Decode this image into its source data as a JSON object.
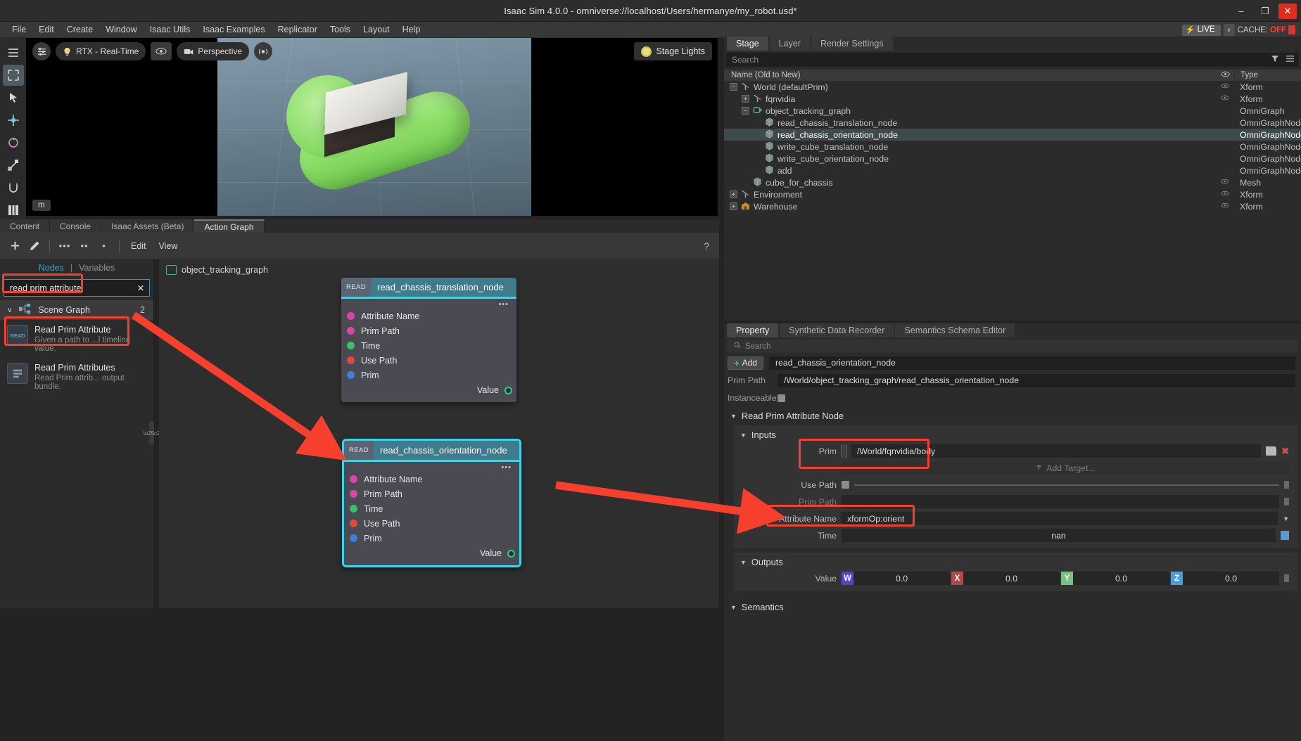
{
  "window": {
    "title": "Isaac Sim 4.0.0 - omniverse://localhost/Users/hermanye/my_robot.usd*",
    "minimize": "–",
    "maximize": "❐",
    "close": "✕"
  },
  "menubar": {
    "items": [
      "File",
      "Edit",
      "Create",
      "Window",
      "Isaac Utils",
      "Isaac Examples",
      "Replicator",
      "Tools",
      "Layout",
      "Help"
    ],
    "live_label": "LIVE",
    "live_bolt": "⚡",
    "live_caret": "∨",
    "cache_label": "CACHE:",
    "cache_value": "OFF"
  },
  "viewport": {
    "toolbar": {
      "settings_icon": "sliders-icon",
      "bulb_icon": "lightbulb-icon",
      "renderer": "RTX - Real-Time",
      "eye_icon": "eye-icon",
      "camera_icon": "camera-icon",
      "camera": "Perspective",
      "sensor_icon": "sensor-icon"
    },
    "stage_lights": "Stage Lights",
    "unit": "m"
  },
  "bottom_tabs": {
    "items": [
      "Content",
      "Console",
      "Isaac Assets (Beta)",
      "Action Graph"
    ],
    "active": "Action Graph"
  },
  "graph_toolbar": {
    "add_icon": "plus-icon",
    "edit_icon": "pencil-icon",
    "dots1": "•••",
    "dots2": "••",
    "dots3": "•",
    "edit": "Edit",
    "view": "View",
    "help": "?"
  },
  "node_library": {
    "tabs": {
      "nodes": "Nodes",
      "separator": "|",
      "variables": "Variables"
    },
    "search_value": "read prim attribute",
    "search_placeholder": "Search",
    "clear_icon": "✕",
    "group": {
      "label": "Scene Graph",
      "count": "2",
      "chevron": "∨",
      "icon": "scene-graph-icon"
    },
    "items": [
      {
        "name": "Read Prim Attribute",
        "desc": "Given a path to ...l timeline value.",
        "icon_text": "READ"
      },
      {
        "name": "Read Prim Attributes",
        "desc": "Read Prim attrib... output bundle.",
        "icon_text": ""
      }
    ]
  },
  "graph": {
    "breadcrumb": "object_tracking_graph",
    "nodes": [
      {
        "badge": "READ",
        "title": "read_chassis_translation_node",
        "dots": "•••",
        "inputs": [
          {
            "label": "Attribute Name",
            "color": "#d946a8"
          },
          {
            "label": "Prim Path",
            "color": "#d946a8"
          },
          {
            "label": "Time",
            "color": "#3bbf70"
          },
          {
            "label": "Use Path",
            "color": "#e04a3d"
          },
          {
            "label": "Prim",
            "color": "#3f7fd6"
          }
        ],
        "output": "Value"
      },
      {
        "badge": "READ",
        "title": "read_chassis_orientation_node",
        "dots": "•••",
        "inputs": [
          {
            "label": "Attribute Name",
            "color": "#d946a8"
          },
          {
            "label": "Prim Path",
            "color": "#d946a8"
          },
          {
            "label": "Time",
            "color": "#3bbf70"
          },
          {
            "label": "Use Path",
            "color": "#e04a3d"
          },
          {
            "label": "Prim",
            "color": "#3f7fd6"
          }
        ],
        "output": "Value"
      }
    ]
  },
  "stage": {
    "tabs": [
      "Stage",
      "Layer",
      "Render Settings"
    ],
    "active_tab": "Stage",
    "search_placeholder": "Search",
    "filter_icon": "filter-icon",
    "menu_icon": "hamburger-icon",
    "columns": {
      "name": "Name (Old to New)",
      "visibility": "eye-icon",
      "type": "Type"
    },
    "rows": [
      {
        "name": "World (defaultPrim)",
        "type": "Xform",
        "indent": 0,
        "expander": "−",
        "icon": "axis",
        "eye": true,
        "selected": false
      },
      {
        "name": "fqnvidia",
        "type": "Xform",
        "indent": 1,
        "expander": "+",
        "icon": "axis",
        "eye": true,
        "selected": false
      },
      {
        "name": "object_tracking_graph",
        "type": "OmniGraph",
        "indent": 1,
        "expander": "−",
        "icon": "graph",
        "eye": false,
        "selected": false
      },
      {
        "name": "read_chassis_translation_node",
        "type": "OmniGraphNode",
        "indent": 2,
        "expander": "",
        "icon": "cube",
        "eye": false,
        "selected": false
      },
      {
        "name": "read_chassis_orientation_node",
        "type": "OmniGraphNode",
        "indent": 2,
        "expander": "",
        "icon": "cube",
        "eye": false,
        "selected": true
      },
      {
        "name": "write_cube_translation_node",
        "type": "OmniGraphNode",
        "indent": 2,
        "expander": "",
        "icon": "cube",
        "eye": false,
        "selected": false
      },
      {
        "name": "write_cube_orientation_node",
        "type": "OmniGraphNode",
        "indent": 2,
        "expander": "",
        "icon": "cube",
        "eye": false,
        "selected": false
      },
      {
        "name": "add",
        "type": "OmniGraphNode",
        "indent": 2,
        "expander": "",
        "icon": "cube",
        "eye": false,
        "selected": false
      },
      {
        "name": "cube_for_chassis",
        "type": "Mesh",
        "indent": 1,
        "expander": "",
        "icon": "cube",
        "eye": true,
        "selected": false
      },
      {
        "name": "Environment",
        "type": "Xform",
        "indent": 0,
        "expander": "+",
        "icon": "axis",
        "eye": true,
        "selected": false
      },
      {
        "name": "Warehouse",
        "type": "Xform",
        "indent": 0,
        "expander": "+",
        "icon": "warehouse",
        "eye": true,
        "selected": false
      }
    ]
  },
  "property": {
    "tabs": [
      "Property",
      "Synthetic Data Recorder",
      "Semantics Schema Editor"
    ],
    "active_tab": "Property",
    "search_placeholder": "Search",
    "search_icon": "search-icon",
    "add_button": "Add",
    "prim_name": "read_chassis_orientation_node",
    "prim_path_label": "Prim Path",
    "prim_path_value": "/World/object_tracking_graph/read_chassis_orientation_node",
    "instanceable_label": "Instanceable",
    "section_title": "Read Prim Attribute Node",
    "inputs_title": "Inputs",
    "outputs_title": "Outputs",
    "semantics_title": "Semantics",
    "fields": {
      "prim_label": "Prim",
      "prim_value": "/World/fqnvidia/body",
      "add_target": "Add Target...",
      "use_path_label": "Use Path",
      "prim_path_label": "Prim Path",
      "prim_path_value": "",
      "attribute_name_label": "Attribute Name",
      "attribute_name_value": "xformOp:orient",
      "time_label": "Time",
      "time_value": "nan",
      "value_label": "Value"
    },
    "output_vector": [
      {
        "tag": "W",
        "value": "0.0",
        "color": "#4f46c8"
      },
      {
        "tag": "X",
        "value": "0.0",
        "color": "#b04a4a"
      },
      {
        "tag": "Y",
        "value": "0.0",
        "color": "#79c182"
      },
      {
        "tag": "Z",
        "value": "0.0",
        "color": "#4f9ed8"
      }
    ],
    "collapse_caret": "▼",
    "dropdown_caret": "▼"
  },
  "annotations": {
    "accent_color": "#f73f2e",
    "boxes": [
      "search-box",
      "read-prim-attribute-item",
      "graph-node-selected",
      "prim-field",
      "attribute-name-field"
    ],
    "arrows": [
      "library-to-node-arrow",
      "node-to-attribute-arrow"
    ]
  }
}
